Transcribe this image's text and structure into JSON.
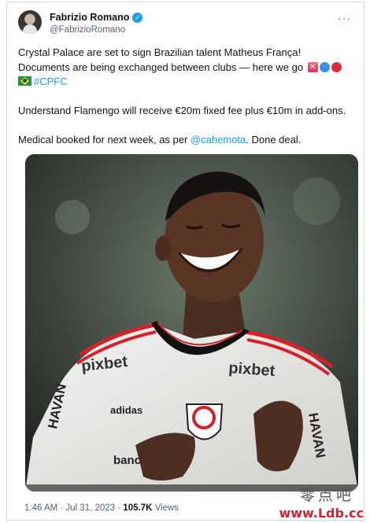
{
  "tweet": {
    "author_name": "Fabrizio Romano",
    "author_handle": "@FabrizioRomano",
    "more_label": "···",
    "line1": "Crystal Palace are set to sign Brazilian talent Matheus França!",
    "line2": "Documents are being exchanged between clubs — here we go",
    "hashtag": "#CPFC",
    "line3": "Understand Flamengo will receive €20m fixed fee plus €10m in add-ons.",
    "line4_pre": "Medical booked for next week, as per ",
    "mention": "@cahemota",
    "line4_post": ". Done deal.",
    "time": "1:46 AM · Jul 31, 2023 · ",
    "views_count": "105.7K",
    "views_label": " Views"
  },
  "photo": {
    "sponsor_chest_left": "pixbet",
    "sponsor_chest_right": "pixbet",
    "kit_brand": "adidas",
    "sleeve_text_left": "HAVAN",
    "sleeve_text_right": "HAVAN",
    "lower_sponsor": "banc",
    "crest_letters": "CRF"
  },
  "watermark": {
    "chinese": "零点吧",
    "url": "www.Ldb.cc"
  },
  "colors": {
    "link": "#1d9bf0",
    "muted": "#536471",
    "verified": "#1d9bf0",
    "watermark_red": "#d81e2f"
  },
  "icons": {
    "verified": "verified-badge-icon",
    "more": "more-options-icon",
    "flag": "brazil-flag-icon"
  }
}
